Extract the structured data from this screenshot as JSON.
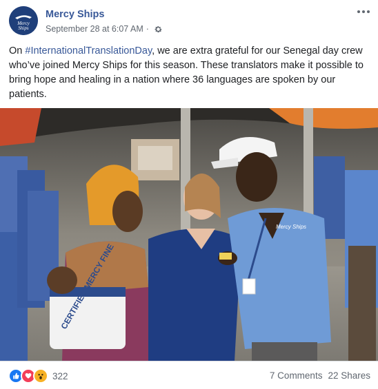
{
  "post": {
    "page_name": "Mercy Ships",
    "timestamp": "September 28 at 6:07 AM",
    "privacy_icon": "gear-icon",
    "avatar_text": "Mercy Ships",
    "text_before": "On ",
    "hashtag": "#InternationalTranslationDay",
    "text_after": ", we are extra grateful for our Senegal day crew who’ve joined Mercy Ships for this season. These translators make it possible to bring hope and healing in a nation where 36 languages are spoken by our patients."
  },
  "photo": {
    "carrier_text": "CERTIFIED MERCY FINE",
    "badge_text": "Mercy Ships"
  },
  "footer": {
    "reaction_icons": [
      "like-icon",
      "love-icon",
      "wow-icon"
    ],
    "reaction_count": "322",
    "comments": "7 Comments",
    "shares": "22 Shares"
  },
  "colors": {
    "link": "#385898",
    "like": "#1877f2",
    "love": "#f33e58",
    "wow": "#f7b125",
    "scrubs": "#2c4b8c",
    "light_scrubs": "#6f9bd6"
  }
}
